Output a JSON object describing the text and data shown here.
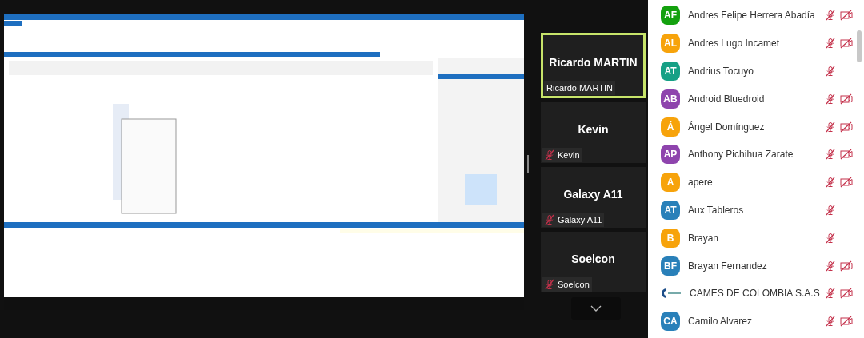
{
  "tiles": [
    {
      "name": "Ricardo MARTIN",
      "caption": "Ricardo MARTIN",
      "speaking": true,
      "muted": false
    },
    {
      "name": "Kevin",
      "caption": "Kevin",
      "speaking": false,
      "muted": true
    },
    {
      "name": "Galaxy A11",
      "caption": "Galaxy A11",
      "speaking": false,
      "muted": true
    },
    {
      "name": "Soelcon",
      "caption": "Soelcon",
      "speaking": false,
      "muted": true
    }
  ],
  "participants": [
    {
      "kind": "initials",
      "initials": "AF",
      "name": "Andres Felipe Herrera Abadía",
      "color": "#13a10e",
      "mic_muted": true,
      "camera_off": true
    },
    {
      "kind": "initials",
      "initials": "AL",
      "name": "Andres Lugo Incamet",
      "color": "#f7a30b",
      "mic_muted": true,
      "camera_off": true
    },
    {
      "kind": "initials",
      "initials": "AT",
      "name": "Andrius Tocuyo",
      "color": "#16a085",
      "mic_muted": true,
      "camera_off": false
    },
    {
      "kind": "initials",
      "initials": "AB",
      "name": "Android Bluedroid",
      "color": "#8e44ad",
      "mic_muted": true,
      "camera_off": true
    },
    {
      "kind": "initials",
      "initials": "Á",
      "name": "Ángel Domínguez",
      "color": "#f7a30b",
      "mic_muted": true,
      "camera_off": true
    },
    {
      "kind": "initials",
      "initials": "AP",
      "name": "Anthony Pichihua Zarate",
      "color": "#8e44ad",
      "mic_muted": true,
      "camera_off": true
    },
    {
      "kind": "initials",
      "initials": "A",
      "name": "apere",
      "color": "#f7a30b",
      "mic_muted": true,
      "camera_off": true
    },
    {
      "kind": "initials",
      "initials": "AT",
      "name": "Aux Tableros",
      "color": "#2980b9",
      "mic_muted": true,
      "camera_off": false
    },
    {
      "kind": "initials",
      "initials": "B",
      "name": "Brayan",
      "color": "#f7a30b",
      "mic_muted": true,
      "camera_off": false
    },
    {
      "kind": "initials",
      "initials": "BF",
      "name": "Brayan Fernandez",
      "color": "#2980b9",
      "mic_muted": true,
      "camera_off": true
    },
    {
      "kind": "logo",
      "name": "CAMES DE COLOMBIA S.A.S",
      "mic_muted": true,
      "camera_off": true
    },
    {
      "kind": "initials",
      "initials": "CA",
      "name": "Camilo Alvarez",
      "color": "#2980b9",
      "mic_muted": true,
      "camera_off": true
    }
  ]
}
